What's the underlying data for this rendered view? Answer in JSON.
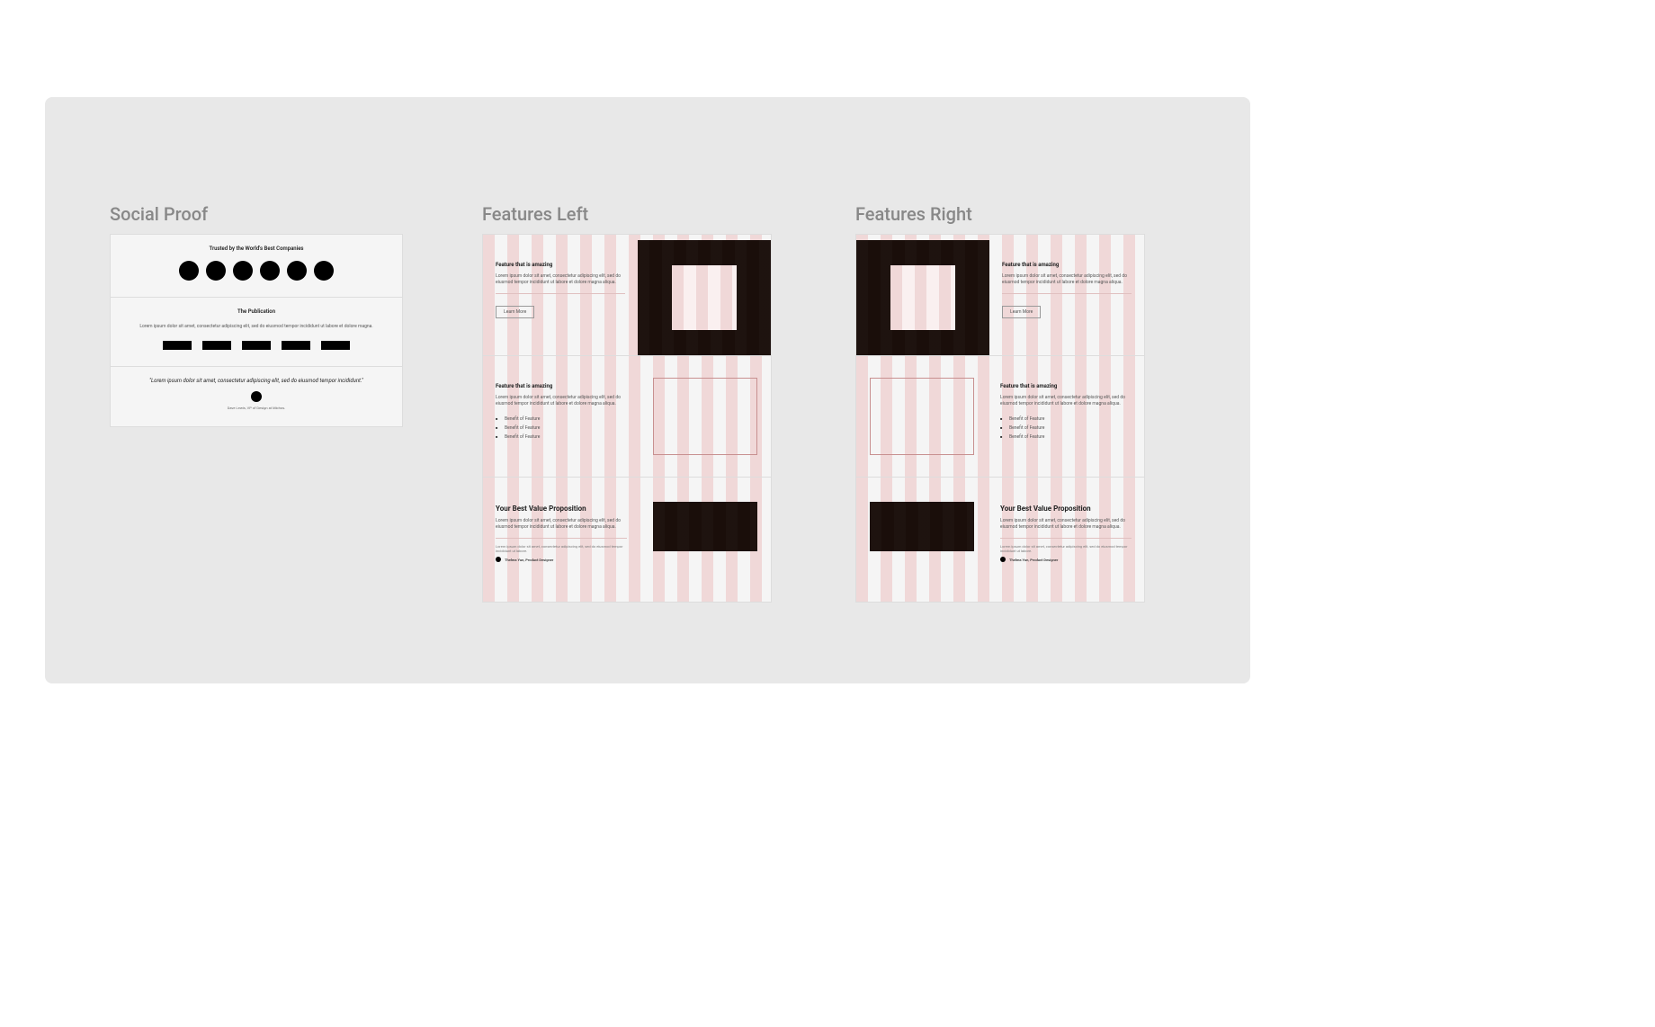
{
  "sections": {
    "social_proof": {
      "title": "Social Proof",
      "trusted_heading": "Trusted by the World's Best Companies",
      "publication_heading": "The Publication",
      "publication_text": "Lorem ipsum dolor sit amet, consectetur adipiscing elit, sed do eiusmod tempor incididunt ut labore et dolore magna.",
      "quote": "\"Lorem ipsum dolor sit amet, consectetur adipiscing elit, sed do eiusmod tempor incididunt.\"",
      "quote_attribution": "Dave Lewis, VP of Design at Michos."
    },
    "features_left": {
      "title": "Features Left",
      "row1": {
        "heading": "Feature that is amazing",
        "body": "Lorem ipsum dolor sit amet, consectetur adipiscing elit, sed do eiusmod tempor incididunt ut labore et dolore magna aliqua.",
        "button": "Learn More"
      },
      "row2": {
        "heading": "Feature that is amazing",
        "body": "Lorem ipsum dolor sit amet, consectetur adipiscing elit, sed do eiusmod tempor incididunt ut labore et dolore magna aliqua.",
        "benefits": [
          "Benefit of Feature",
          "Benefit of Feature",
          "Benefit of Feature"
        ]
      },
      "row3": {
        "heading": "Your Best Value Proposition",
        "body": "Lorem ipsum dolor sit amet, consectetur adipiscing elit, sed do eiusmod tempor incididunt ut labore et dolore magna aliqua.",
        "testimonial": "Lorem ipsum dolor sit amet, consectetur adipiscing elit, sed do eiusmod tempor incididunt ut labore.",
        "person": "Thelma Yun, Product Designer"
      }
    },
    "features_right": {
      "title": "Features Right",
      "row1": {
        "heading": "Feature that is amazing",
        "body": "Lorem ipsum dolor sit amet, consectetur adipiscing elit, sed do eiusmod tempor incididunt ut labore et dolore magna aliqua.",
        "button": "Learn More"
      },
      "row2": {
        "heading": "Feature that is amazing",
        "body": "Lorem ipsum dolor sit amet, consectetur adipiscing elit, sed do eiusmod tempor incididunt ut labore et dolore magna aliqua.",
        "benefits": [
          "Benefit of Feature",
          "Benefit of Feature",
          "Benefit of Feature"
        ]
      },
      "row3": {
        "heading": "Your Best Value Proposition",
        "body": "Lorem ipsum dolor sit amet, consectetur adipiscing elit, sed do eiusmod tempor incididunt ut labore et dolore magna aliqua.",
        "testimonial": "Lorem ipsum dolor sit amet, consectetur adipiscing elit, sed do eiusmod tempor incididunt ut labore.",
        "person": "Thelma Yun, Product Designer"
      }
    }
  }
}
